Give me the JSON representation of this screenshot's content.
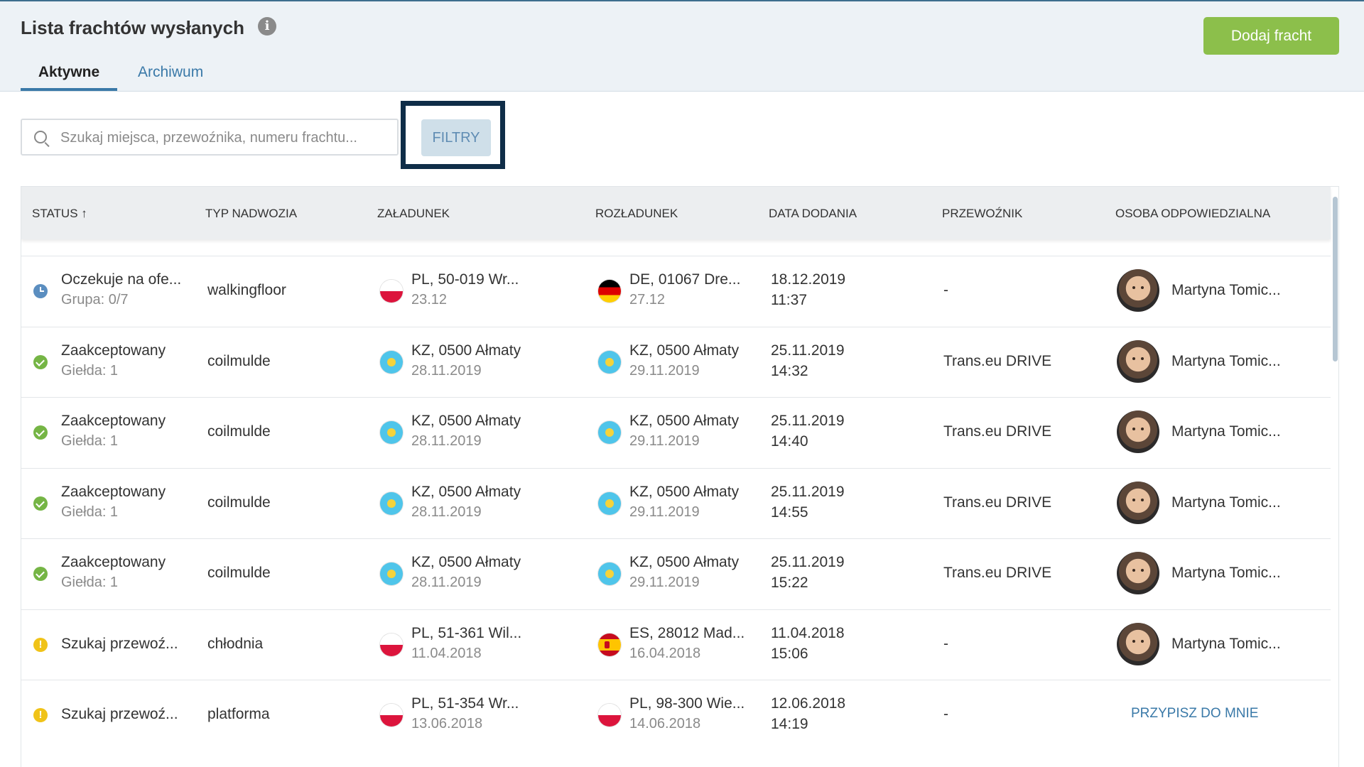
{
  "page": {
    "title": "Lista frachtów wysłanych",
    "add_button": "Dodaj fracht",
    "tabs": [
      {
        "label": "Aktywne",
        "active": true
      },
      {
        "label": "Archiwum",
        "active": false
      }
    ]
  },
  "search": {
    "placeholder": "Szukaj miejsca, przewoźnika, numeru frachtu...",
    "value": ""
  },
  "filters": {
    "label": "FILTRY"
  },
  "table": {
    "columns": [
      "STATUS ↑",
      "TYP NADWOZIA",
      "ZAŁADUNEK",
      "ROZŁADUNEK",
      "DATA DODANIA",
      "PRZEWOŹNIK",
      "OSOBA ODPOWIEDZIALNA"
    ],
    "rows": [
      {
        "status_icon": "clock-icon",
        "status": "Oczekuje na ofe...",
        "status_sub": "Grupa: 0/7",
        "body": "walkingfloor",
        "load_flag": "flag-pl",
        "load": "PL, 50-019 Wr...",
        "load_date": "23.12",
        "unload_flag": "flag-de",
        "unload": "DE, 01067 Dre...",
        "unload_date": "27.12",
        "added_date": "18.12.2019",
        "added_time": "11:37",
        "carrier": "-",
        "person": "Martyna Tomic..."
      },
      {
        "status_icon": "check-icon",
        "status": "Zaakceptowany",
        "status_sub": "Giełda: 1",
        "body": "coilmulde",
        "load_flag": "flag-kz",
        "load": "KZ, 0500 Ałmaty",
        "load_date": "28.11.2019",
        "unload_flag": "flag-kz",
        "unload": "KZ, 0500 Ałmaty",
        "unload_date": "29.11.2019",
        "added_date": "25.11.2019",
        "added_time": "14:32",
        "carrier": "Trans.eu DRIVE",
        "person": "Martyna Tomic..."
      },
      {
        "status_icon": "check-icon",
        "status": "Zaakceptowany",
        "status_sub": "Giełda: 1",
        "body": "coilmulde",
        "load_flag": "flag-kz",
        "load": "KZ, 0500 Ałmaty",
        "load_date": "28.11.2019",
        "unload_flag": "flag-kz",
        "unload": "KZ, 0500 Ałmaty",
        "unload_date": "29.11.2019",
        "added_date": "25.11.2019",
        "added_time": "14:40",
        "carrier": "Trans.eu DRIVE",
        "person": "Martyna Tomic..."
      },
      {
        "status_icon": "check-icon",
        "status": "Zaakceptowany",
        "status_sub": "Giełda: 1",
        "body": "coilmulde",
        "load_flag": "flag-kz",
        "load": "KZ, 0500 Ałmaty",
        "load_date": "28.11.2019",
        "unload_flag": "flag-kz",
        "unload": "KZ, 0500 Ałmaty",
        "unload_date": "29.11.2019",
        "added_date": "25.11.2019",
        "added_time": "14:55",
        "carrier": "Trans.eu DRIVE",
        "person": "Martyna Tomic..."
      },
      {
        "status_icon": "check-icon",
        "status": "Zaakceptowany",
        "status_sub": "Giełda: 1",
        "body": "coilmulde",
        "load_flag": "flag-kz",
        "load": "KZ, 0500 Ałmaty",
        "load_date": "28.11.2019",
        "unload_flag": "flag-kz",
        "unload": "KZ, 0500 Ałmaty",
        "unload_date": "29.11.2019",
        "added_date": "25.11.2019",
        "added_time": "15:22",
        "carrier": "Trans.eu DRIVE",
        "person": "Martyna Tomic..."
      },
      {
        "status_icon": "warning-icon",
        "status": "Szukaj przewoź...",
        "status_sub": "",
        "body": "chłodnia",
        "load_flag": "flag-pl",
        "load": "PL, 51-361 Wil...",
        "load_date": "11.04.2018",
        "unload_flag": "flag-es",
        "unload": "ES, 28012 Mad...",
        "unload_date": "16.04.2018",
        "added_date": "11.04.2018",
        "added_time": "15:06",
        "carrier": "-",
        "person": "Martyna Tomic..."
      },
      {
        "status_icon": "warning-icon",
        "status": "Szukaj przewoź...",
        "status_sub": "",
        "body": "platforma",
        "load_flag": "flag-pl",
        "load": "PL, 51-354 Wr...",
        "load_date": "13.06.2018",
        "unload_flag": "flag-pl",
        "unload": "PL, 98-300 Wie...",
        "unload_date": "14.06.2018",
        "added_date": "12.06.2018",
        "added_time": "14:19",
        "carrier": "-",
        "person": "",
        "assign_link": "PRZYPISZ DO MNIE"
      }
    ]
  }
}
